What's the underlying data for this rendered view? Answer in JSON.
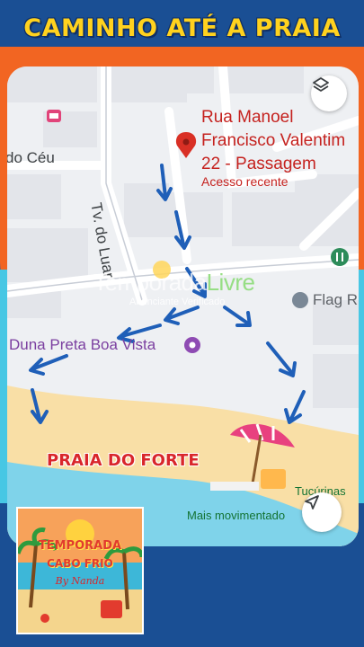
{
  "title": "CAMINHO ATÉ A PRAIA",
  "map": {
    "destination": {
      "line1": "Rua Manoel",
      "line2": "Francisco Valentim",
      "line3": "22 - Passagem",
      "status": "Acesso recente"
    },
    "labels": {
      "neighborhood": "do Céu",
      "street": "Tv. do Luar",
      "poi_duna": "Duna Preta Boa Vista",
      "poi_flag": "Flag R",
      "poi_beach_right": "Tucúrinas",
      "busy": "Mais movimentado"
    },
    "beach_label": "PRAIA DO FORTE",
    "watermark": {
      "brand_prefix": "Temporada",
      "brand_suffix": "Livre",
      "tagline": "Anunciante Verificado"
    }
  },
  "logo": {
    "line1": "TEMPORADA",
    "line2": "CABO FRIO",
    "line3": "By Nanda"
  },
  "colors": {
    "background_navy": "#1a4f94",
    "orange": "#f26522",
    "cyan": "#47c7e4",
    "title_yellow": "#ffd21e",
    "arrow_blue": "#1f5fb8",
    "pin_red": "#d93025",
    "beach_label_red": "#d9262b"
  },
  "icons": [
    "layers-icon",
    "location-pin-icon",
    "hotel-icon",
    "camera-icon",
    "restroom-icon",
    "navigation-arrow-icon",
    "beach-umbrella-icon"
  ]
}
